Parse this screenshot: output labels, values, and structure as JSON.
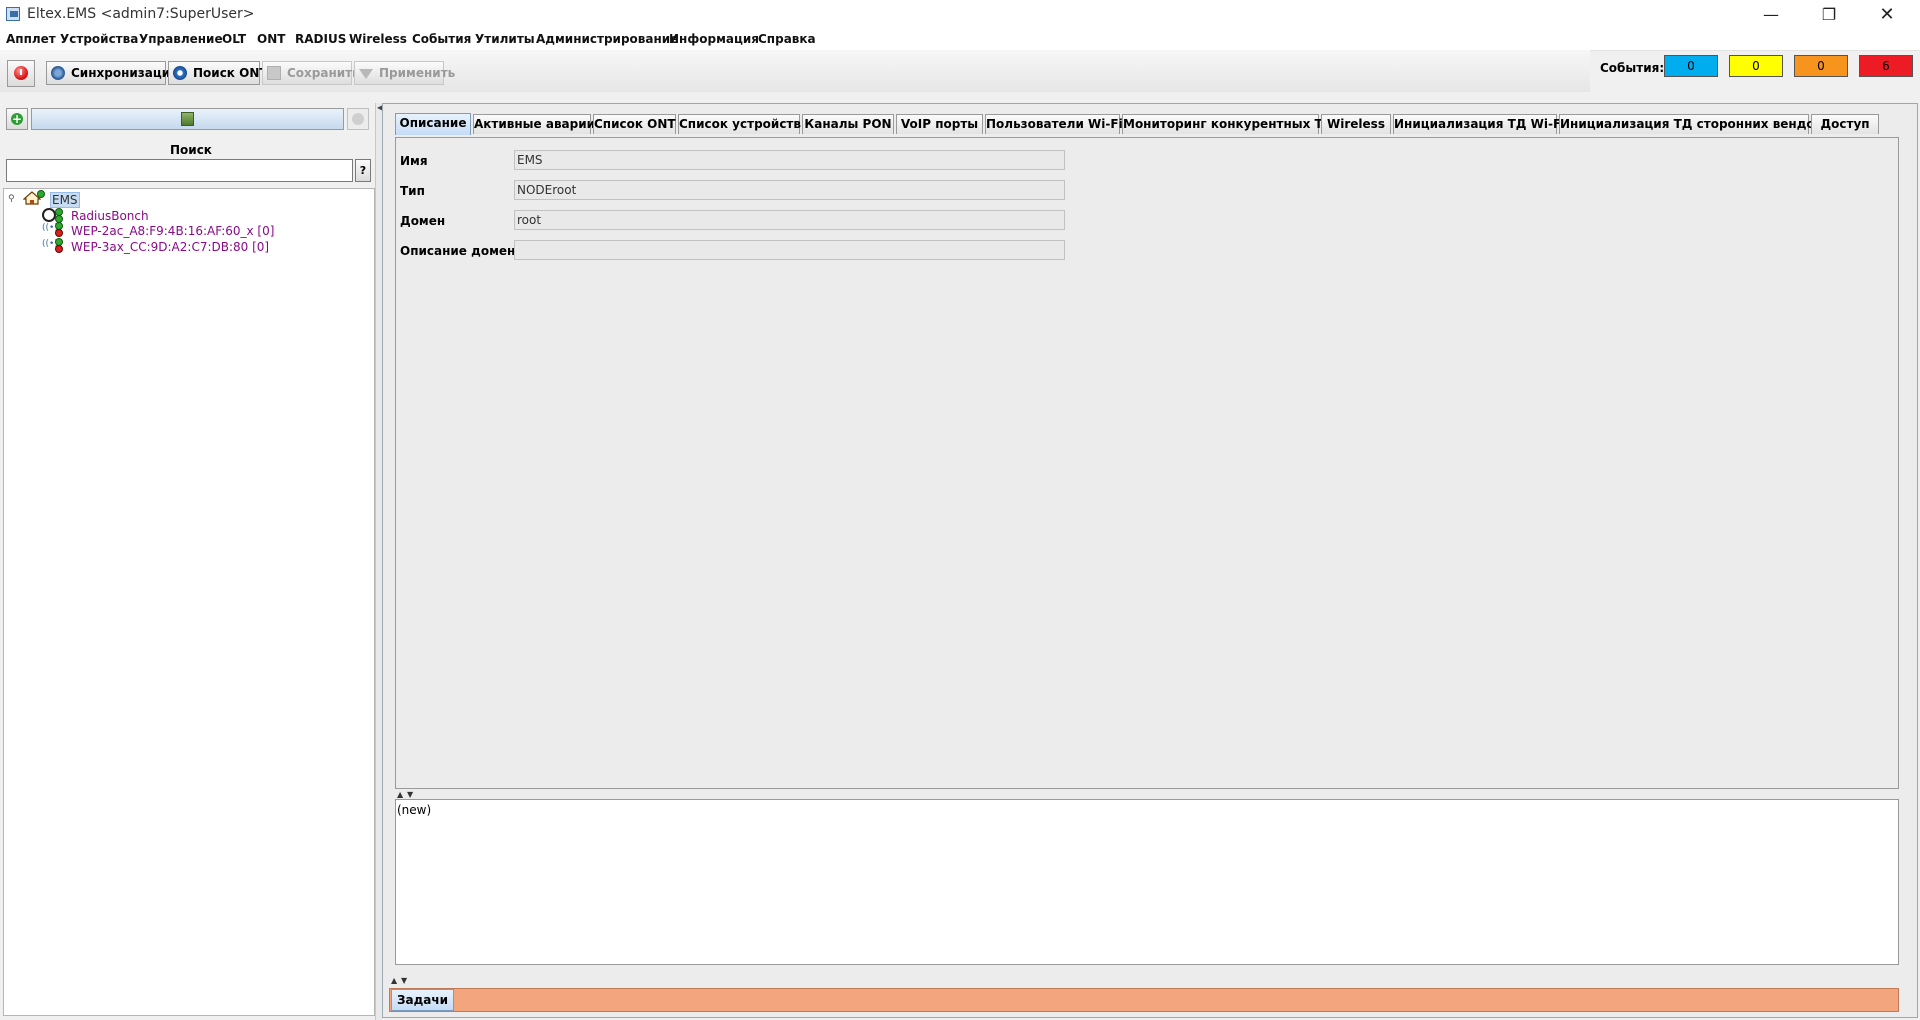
{
  "window": {
    "title": "Eltex.EMS <admin7:SuperUser>",
    "minimize": "—",
    "maximize": "❐",
    "close": "✕"
  },
  "menu": [
    "Апплет",
    "Устройства",
    "Управление",
    "OLT",
    "ONT",
    "RADIUS",
    "Wireless",
    "События",
    "Утилиты",
    "Администрирование",
    "Информация",
    "Справка"
  ],
  "toolbar": {
    "sync_label": "Синхронизация",
    "search_ont_label": "Поиск ONT",
    "save_label": "Сохранить",
    "apply_label": "Применить"
  },
  "events": {
    "label": "События:",
    "badges": [
      {
        "value": "0",
        "color": "#00aeef"
      },
      {
        "value": "0",
        "color": "#ffff00"
      },
      {
        "value": "0",
        "color": "#f7941d"
      },
      {
        "value": "6",
        "color": "#ed1c24"
      }
    ]
  },
  "left": {
    "search_label": "Поиск",
    "search_value": "",
    "help_label": "?",
    "tree": {
      "root": "EMS",
      "children": [
        "RadiusBonch",
        "WEP-2ac_A8:F9:4B:16:AF:60_x [0]",
        "WEP-3ax_CC:9D:A2:C7:DB:80 [0]"
      ]
    }
  },
  "tabs": [
    "Описание",
    "Активные аварии",
    "Список ONT",
    "Список устройств",
    "Каналы PON",
    "VoIP порты",
    "Пользователи Wi-Fi",
    "Мониторинг конкурентных ТД",
    "Wireless",
    "Инициализация ТД Wi-Fi",
    "Инициализация ТД сторонних вендоров",
    "Доступ"
  ],
  "form": {
    "name_label": "Имя",
    "name_value": "EMS",
    "type_label": "Тип",
    "type_value": "NODEroot",
    "domain_label": "Домен",
    "domain_value": "root",
    "domain_desc_label": "Описание домена",
    "domain_desc_value": ""
  },
  "log_text": "(new)",
  "tasks_tab": "Задачи"
}
